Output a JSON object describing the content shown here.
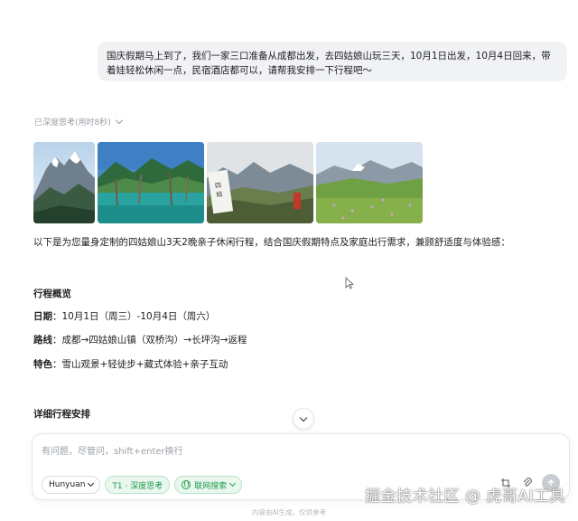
{
  "user_message": "国庆假期马上到了，我们一家三口准备从成都出发，去四姑娘山玩三天，10月1日出发，10月4日回来，带着娃轻松休闲一点，民宿酒店都可以，请帮我安排一下行程吧～",
  "thinking_status": "已深度思考(用时8秒)",
  "images": [
    {
      "name": "snow-mountain-photo"
    },
    {
      "name": "lake-photo"
    },
    {
      "name": "mountain-sign-photo"
    },
    {
      "name": "meadow-photo"
    }
  ],
  "answer": {
    "intro": "以下是为您量身定制的四姑娘山3天2晚亲子休闲行程，结合国庆假期特点及家庭出行需求，兼顾舒适度与体验感：",
    "overview_title": "行程概览",
    "date_label": "日期",
    "date_value": "：10月1日（周三）-10月4日（周六）",
    "route_label": "路线",
    "route_value": "：成都→四姑娘山镇（双桥沟）→长坪沟→返程",
    "feature_label": "特色",
    "feature_value": "：雪山观景+轻徒步+藏式体验+亲子互动",
    "details_title": "详细行程安排"
  },
  "input": {
    "placeholder": "有问题，尽管问，shift+enter换行",
    "model_chip": "Hunyuan",
    "think_chip": "T1 · 深度思考",
    "search_chip": "联网搜索"
  },
  "disclaimer": "内容由AI生成，仅供参考",
  "watermark": "掘金技术社区 @ 虎哥AI工具",
  "colors": {
    "accent_green": "#1e9a4c",
    "bubble_bg": "#f1f2f4"
  }
}
